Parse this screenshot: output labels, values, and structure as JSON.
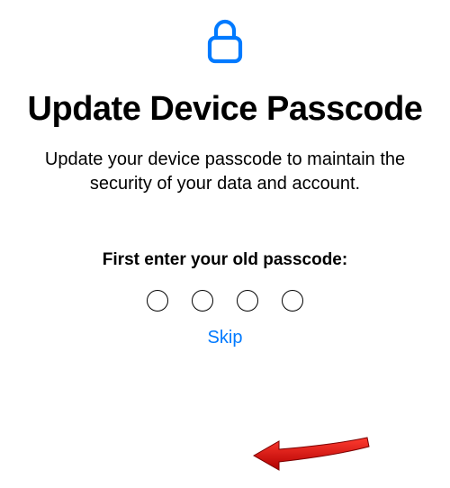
{
  "icon": "lock-icon",
  "title": "Update Device Passcode",
  "subtitle": "Update your device passcode to maintain the security of your data and account.",
  "prompt": "First enter your old passcode:",
  "passcode": {
    "length": 4,
    "entered": 0
  },
  "skip_label": "Skip",
  "colors": {
    "accent": "#007AFF",
    "annotation": "#D21C1C"
  }
}
